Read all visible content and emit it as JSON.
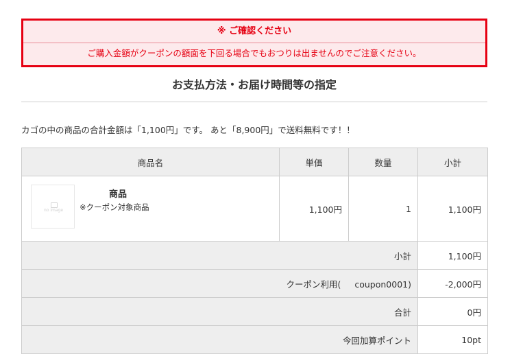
{
  "notice": {
    "title": "※ ご確認ください",
    "body": "ご購入金額がクーポンの額面を下回る場合でもおつりは出ませんのでご注意ください。"
  },
  "section": {
    "title": "お支払方法・お届け時間等の指定"
  },
  "summary_text": "カゴの中の商品の合計金額は「1,100円」です。 あと「8,900円」で送料無料です！！",
  "table": {
    "headers": {
      "product": "商品名",
      "unit_price": "単価",
      "quantity": "数量",
      "subtotal": "小計"
    },
    "item": {
      "thumbnail_text": "no image",
      "name": "商品",
      "note": "※クーポン対象商品",
      "unit_price": "1,100円",
      "quantity": "1",
      "subtotal": "1,100円"
    },
    "totals": {
      "subtotal_label": "小計",
      "subtotal_value": "1,100円",
      "coupon_label": "クーポン利用(",
      "coupon_code": "coupon0001)",
      "coupon_value": "-2,000円",
      "total_label": "合計",
      "total_value": "0円",
      "points_label": "今回加算ポイント",
      "points_value": "10pt"
    }
  },
  "colors": {
    "accent_red": "#e60012",
    "notice_bg": "#fdeaec",
    "table_header_bg": "#eeeeee",
    "border": "#cccccc"
  }
}
